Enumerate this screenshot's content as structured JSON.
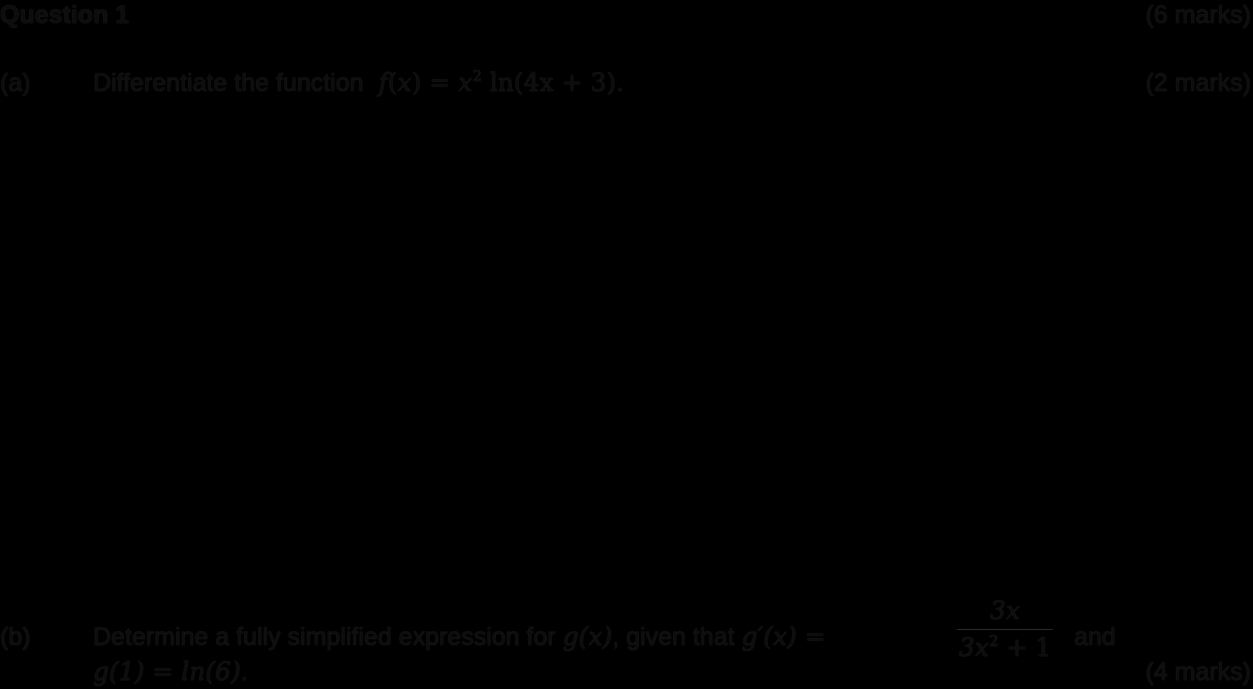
{
  "question": {
    "title": "Question 1",
    "total_marks": "(6 marks)"
  },
  "part_a": {
    "label": "(a)",
    "text": "Differentiate the function",
    "expr_f": "f",
    "expr_lhs_open": "(",
    "expr_x": "x",
    "expr_lhs_close": ")",
    "expr_eq": " = ",
    "expr_x2": "x",
    "expr_pow": "2",
    "expr_ln": " ln",
    "expr_arg": "(4x + 3)",
    "expr_end": ".",
    "marks": "(2 marks)"
  },
  "part_b": {
    "label": "(b)",
    "text_1": "Determine a fully simplified expression for",
    "g_of_x": "g(x)",
    "text_2": ", given that",
    "gprime": "g′(x) =",
    "frac_num": "3x",
    "frac_den_a": "3x",
    "frac_den_pow": "2",
    "frac_den_b": " + 1",
    "text_and": "and",
    "condition": "g(1) = ln(6)",
    "condition_end": ".",
    "marks": "(4 marks)"
  }
}
